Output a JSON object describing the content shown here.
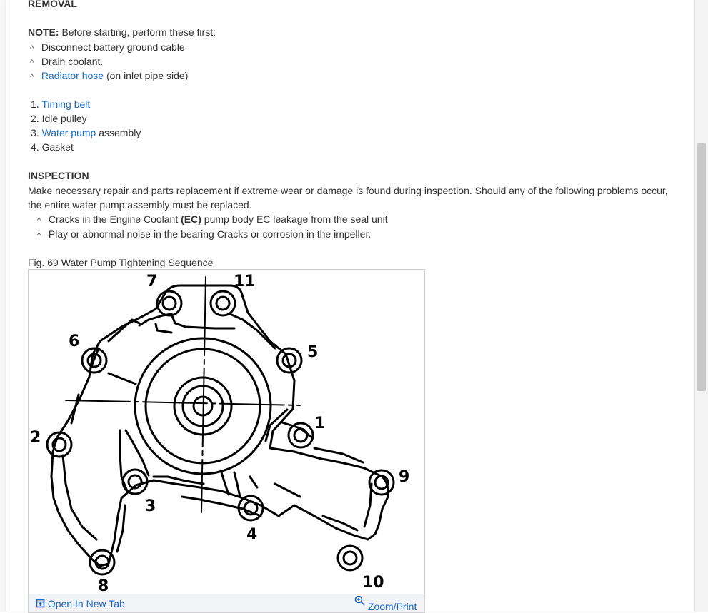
{
  "removal": {
    "heading": "REMOVAL",
    "note_label": "NOTE:",
    "note_text": " Before starting, perform these first:",
    "prereqs": [
      {
        "text": "Disconnect battery ground cable"
      },
      {
        "text": "Drain coolant."
      },
      {
        "link": "Radiator hose",
        "suffix": " (on inlet pipe side)"
      }
    ],
    "steps": [
      {
        "num": "1.",
        "link": "Timing belt",
        "suffix": ""
      },
      {
        "num": "2.",
        "text": "Idle pulley"
      },
      {
        "num": "3.",
        "link": "Water pump",
        "suffix": " assembly"
      },
      {
        "num": "4.",
        "text": "Gasket"
      }
    ]
  },
  "inspection": {
    "heading": "INSPECTION",
    "paragraph": " Make necessary repair and parts replacement if extreme wear or damage is found during inspection. Should any of the following problems occur, the entire water pump assembly must be replaced.",
    "bullet1_pre": "Cracks in the Engine Coolant ",
    "bullet1_bold": "(EC)",
    "bullet1_post": " pump body EC leakage from the seal unit",
    "bullet2": "Play or abnormal noise in the bearing Cracks or corrosion in the impeller."
  },
  "figure": {
    "caption": "Fig. 69 Water Pump Tightening Sequence",
    "bolt_labels": [
      "1",
      "2",
      "3",
      "4",
      "5",
      "6",
      "7",
      "8",
      "9",
      "10",
      "11"
    ],
    "open_new_tab": "Open In New Tab",
    "zoom_print": "Zoom/Print"
  },
  "bullet_glyph": "^",
  "colors": {
    "link": "#1a6ac4",
    "text": "#333333",
    "footer_bg": "#f1f3f6"
  }
}
